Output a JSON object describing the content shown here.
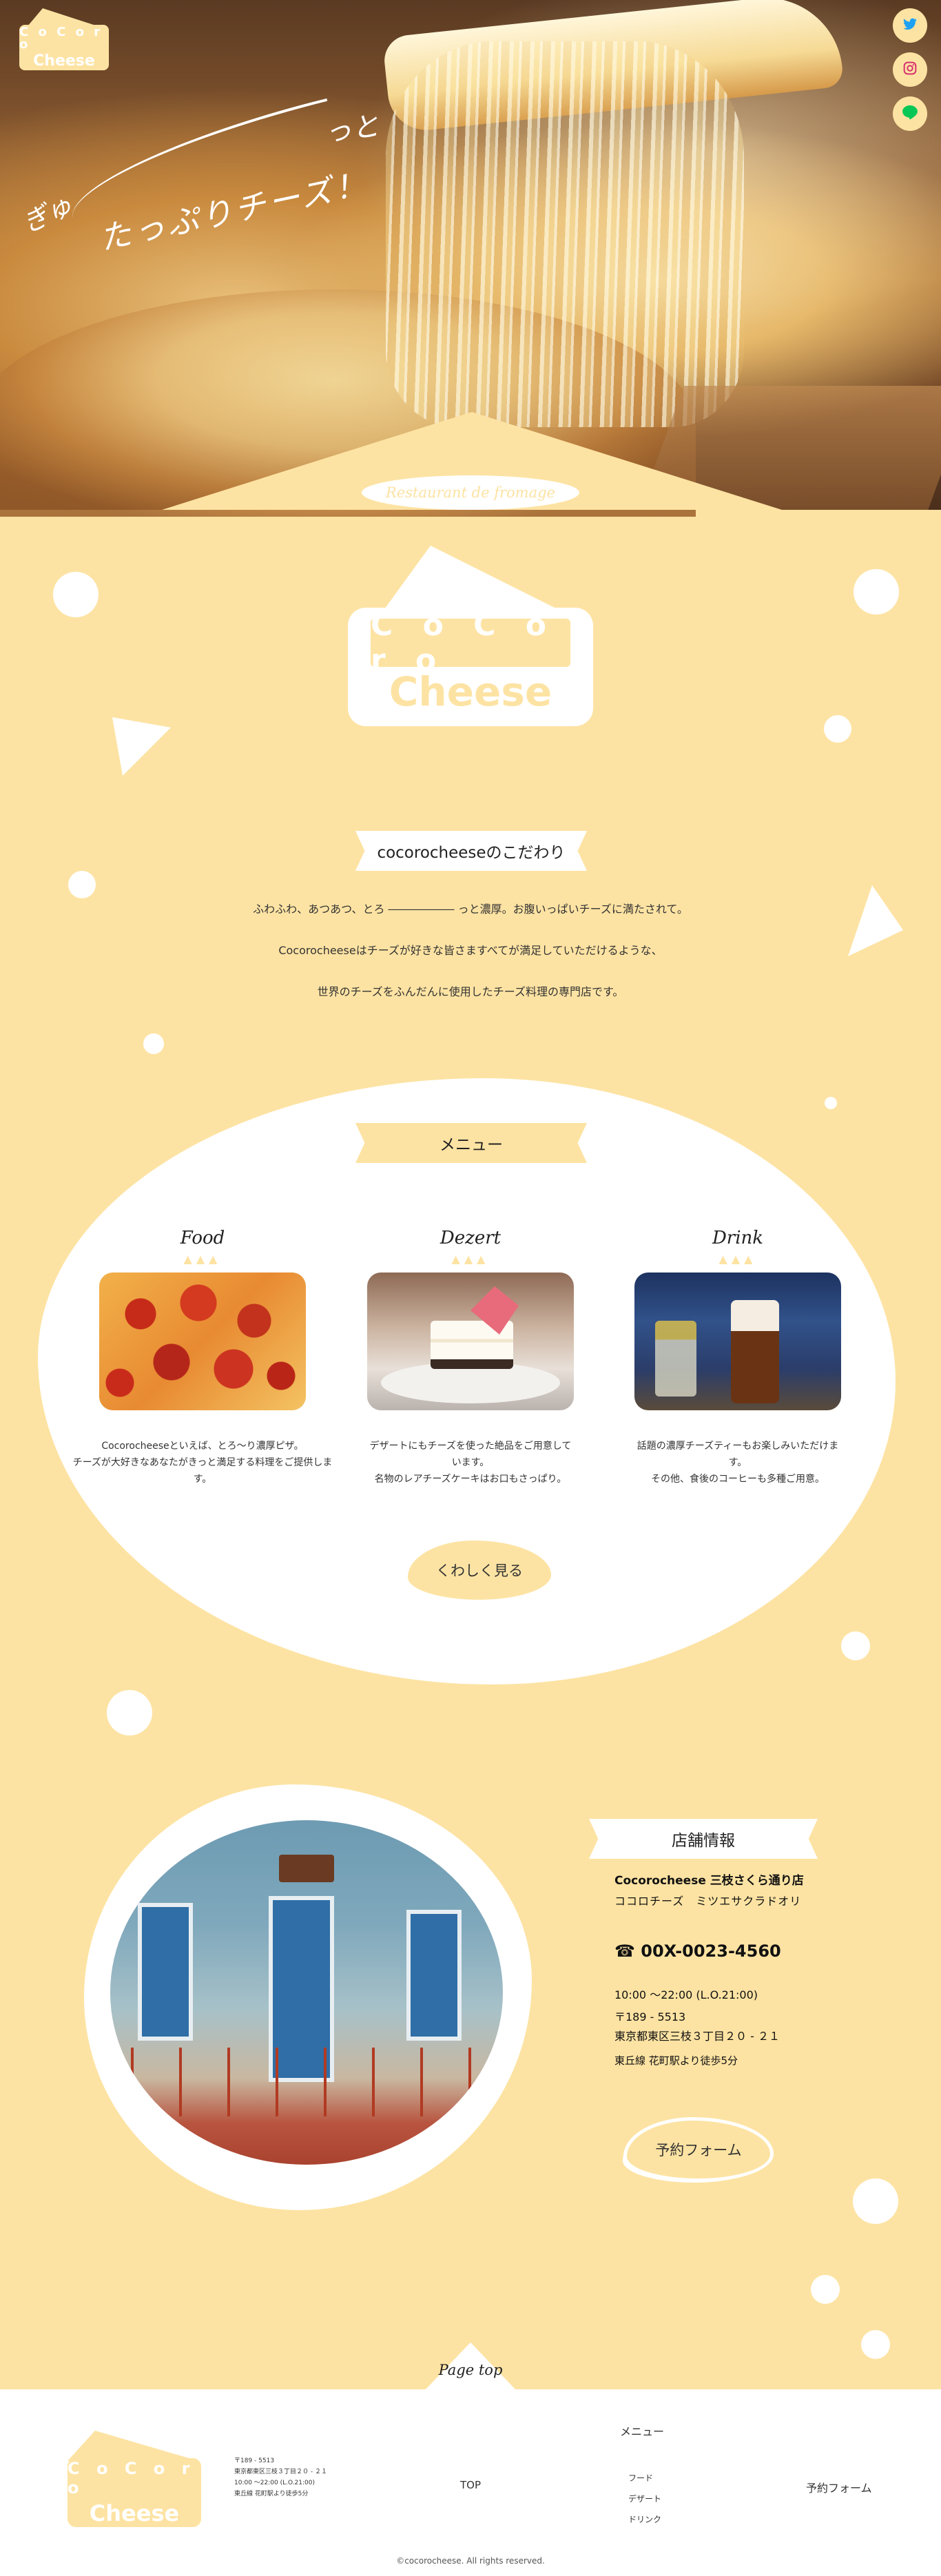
{
  "hero": {
    "catch_1": "ぎゅ",
    "catch_2": "っと",
    "catch_3": "たっぷりチーズ！",
    "tagline": "Restaurant de fromage"
  },
  "logo": {
    "line1": "C o C o r o",
    "line2": "Cheese"
  },
  "social": {
    "twitter": "twitter-icon",
    "instagram": "instagram-icon",
    "line": "line-icon",
    "line_label": "LINE"
  },
  "concept": {
    "heading": "cocorocheeseのこだわり",
    "lines": [
      "ふわふわ、あつあつ、とろ ―――――― っと濃厚。お腹いっぱいチーズに満たされて。",
      "Cocorocheeseはチーズが好きな皆さますべてが満足していただけるような、",
      "世界のチーズをふんだんに使用したチーズ料理の専門店です。"
    ]
  },
  "menu": {
    "heading": "メニュー",
    "items": [
      {
        "title": "Food",
        "desc_1": "Cocorocheeseといえば、とろ～り濃厚ピザ。",
        "desc_2": "チーズが大好きなあなたがきっと満足する料理をご提供します。"
      },
      {
        "title": "Dezert",
        "desc_1": "デザートにもチーズを使った絶品をご用意しています。",
        "desc_2": "名物のレアチーズケーキはお口もさっぱり。"
      },
      {
        "title": "Drink",
        "desc_1": "話題の濃厚チーズティーもお楽しみいただけます。",
        "desc_2": "その他、食後のコーヒーも多種ご用意。"
      }
    ],
    "more_label": "くわしく見る"
  },
  "shop": {
    "heading": "店舗情報",
    "name": "Cocorocheese 三枝さくら通り店",
    "kana": "ココロチーズ　ミツエサクラドオリ",
    "tel": "☎ 00X-0023-4560",
    "hours": "10:00 ～22:00 (L.O.21:00)",
    "postal": "〒189 - 5513",
    "address": "東京都東区三枝３丁目２０ - ２１",
    "access": "東丘線 花町駅より徒歩5分",
    "reserve_label": "予約フォーム"
  },
  "footer": {
    "pagetop": "Page top",
    "info": [
      "〒189 - 5513",
      "東京都東区三枝３丁目２０ - ２１",
      "10:00 ～22:00 (L.O.21:00)",
      "東丘線 花町駅より徒歩5分"
    ],
    "nav_top": "TOP",
    "nav_menu_heading": "メニュー",
    "nav_menu_items": [
      "フード",
      "デザート",
      "ドリンク"
    ],
    "nav_reserve": "予約フォーム",
    "copyright": "©cocorocheese. All rights reserved."
  },
  "colors": {
    "accent": "#fde3a3",
    "white": "#ffffff",
    "text": "#333333"
  }
}
